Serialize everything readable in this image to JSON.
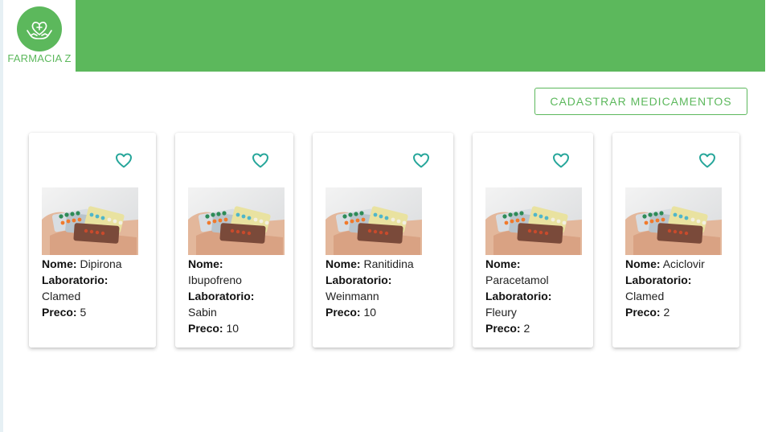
{
  "brand": {
    "name": "FARMACIA Z",
    "color": "#5cb85c"
  },
  "actions": {
    "cadastrar_label": "CADASTRAR MEDICAMENTOS"
  },
  "labels": {
    "nome": "Nome:",
    "laboratorio": "Laboratorio:",
    "preco": "Preco:"
  },
  "icons": {
    "favorite": "heart-outline-icon",
    "logo": "hands-heart-cross-icon"
  },
  "medicamentos": [
    {
      "nome": "Dipirona",
      "laboratorio": "Clamed",
      "preco": "5"
    },
    {
      "nome": "Ibupofreno",
      "laboratorio": "Sabin",
      "preco": "10"
    },
    {
      "nome": "Ranitidina",
      "laboratorio": "Weinmann",
      "preco": "10"
    },
    {
      "nome": "Paracetamol",
      "laboratorio": "Fleury",
      "preco": "2"
    },
    {
      "nome": "Aciclovir",
      "laboratorio": "Clamed",
      "preco": "2"
    }
  ]
}
